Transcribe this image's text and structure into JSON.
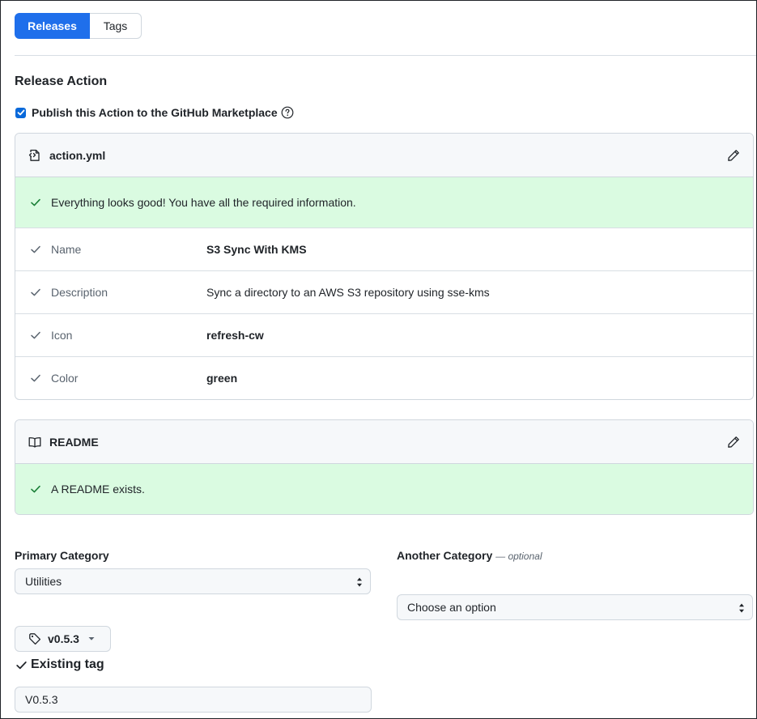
{
  "tabs": [
    {
      "label": "Releases",
      "active": true
    },
    {
      "label": "Tags",
      "active": false
    }
  ],
  "section_title": "Release Action",
  "publish": {
    "label": "Publish this Action to the GitHub Marketplace",
    "checked": true
  },
  "action_box": {
    "title": "action.yml",
    "success_message": "Everything looks good! You have all the required information.",
    "fields": [
      {
        "name": "Name",
        "value": "S3 Sync With KMS",
        "bold": true
      },
      {
        "name": "Description",
        "value": "Sync a directory to an AWS S3 repository using sse-kms",
        "bold": false
      },
      {
        "name": "Icon",
        "value": "refresh-cw",
        "bold": true
      },
      {
        "name": "Color",
        "value": "green",
        "bold": true
      }
    ]
  },
  "readme_box": {
    "title": "README",
    "success_message": "A README exists."
  },
  "primary_category": {
    "label": "Primary Category",
    "value": "Utilities"
  },
  "another_category": {
    "label": "Another Category",
    "optional": "— optional",
    "value": "Choose an option"
  },
  "tag": {
    "button_label": "v0.5.3",
    "status": "Existing tag",
    "input_value": "V0.5.3"
  },
  "colors": {
    "accent": "#1f6feb",
    "success_bg": "#dafbe1",
    "success_icon": "#1a7f37",
    "border": "#d0d7de"
  }
}
